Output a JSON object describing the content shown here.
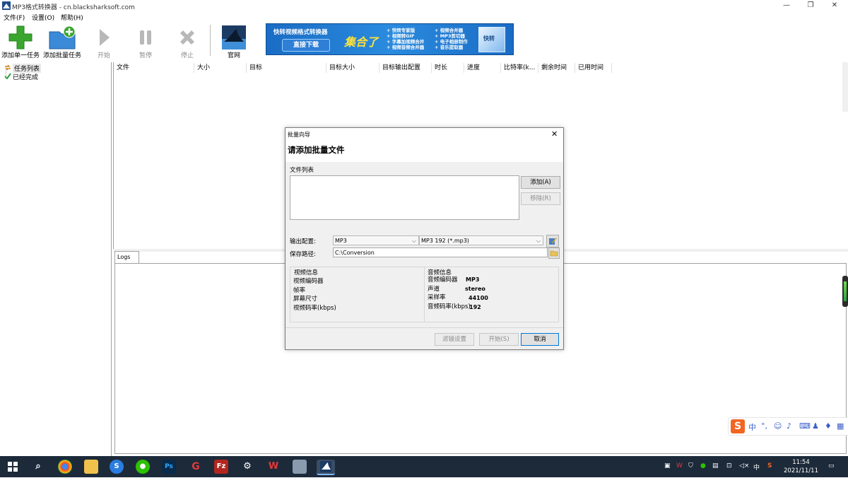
{
  "window": {
    "title": "MP3格式转换器 - cn.blacksharksoft.com",
    "minimize": "—",
    "restore": "❐",
    "close": "✕"
  },
  "menu": [
    "文件(F)",
    "设置(O)",
    "帮助(H)"
  ],
  "toolbar": {
    "add_single": "添加单一任务",
    "add_batch": "添加批量任务",
    "start": "开始",
    "pause": "暂停",
    "stop": "停止",
    "website": "官网"
  },
  "banner": {
    "title": "快转视频格式转换器",
    "download": "直接下载",
    "collection": "集合了",
    "features_col1": [
      "+ 快转专家版",
      "+ 视频转GIF",
      "+ 字幕加视频合并",
      "+ 视频音频合并器"
    ],
    "features_col2": [
      "+ 视频合并器",
      "+ MP3剪切器",
      "+ 电子相册制作",
      "+ 音乐提取器"
    ],
    "box_label": "快转"
  },
  "tree": {
    "task_list": "任务列表",
    "completed": "已经完成"
  },
  "table": {
    "columns": [
      "文件",
      "大小",
      "目标",
      "目标大小",
      "目标输出配置",
      "时长",
      "进度",
      "比特率(k...",
      "剩余时间",
      "已用时间"
    ]
  },
  "logs_tab": "Logs",
  "dialog": {
    "caption": "批量向导",
    "heading": "请添加批量文件",
    "close": "✕",
    "file_list_label": "文件列表",
    "add_button": "添加(A)",
    "remove_button": "移除(R)",
    "output_config_label": "输出配置:",
    "format_value": "MP3",
    "preset_value": "MP3 192 (*.mp3)",
    "save_path_label": "保存路径:",
    "save_path_value": "C:\\Conversion",
    "video_info": {
      "title": "视频信息",
      "rows": [
        "视频编码器",
        "帧率",
        "屏幕尺寸",
        "视频码率(kbps)"
      ]
    },
    "audio_info": {
      "title": "音频信息",
      "rows": [
        {
          "label": "音频编码器",
          "value": "MP3"
        },
        {
          "label": "声道",
          "value": "stereo"
        },
        {
          "label": "采样率",
          "value": "44100"
        },
        {
          "label": "音频码率(kbps)",
          "value": "192"
        }
      ]
    },
    "filter_button": "滤镜设置",
    "start_button": "开始(S)",
    "cancel_button": "取消"
  },
  "ime": {
    "logo": "S",
    "lang": "中",
    "punct": "°,"
  },
  "taskbar": {
    "time": "11:54",
    "date": "2021/11/11",
    "lang": "中"
  },
  "colors": {
    "accent": "#0078d7",
    "taskbar": "#1c2a3a",
    "banner": "#1a6cc4"
  }
}
